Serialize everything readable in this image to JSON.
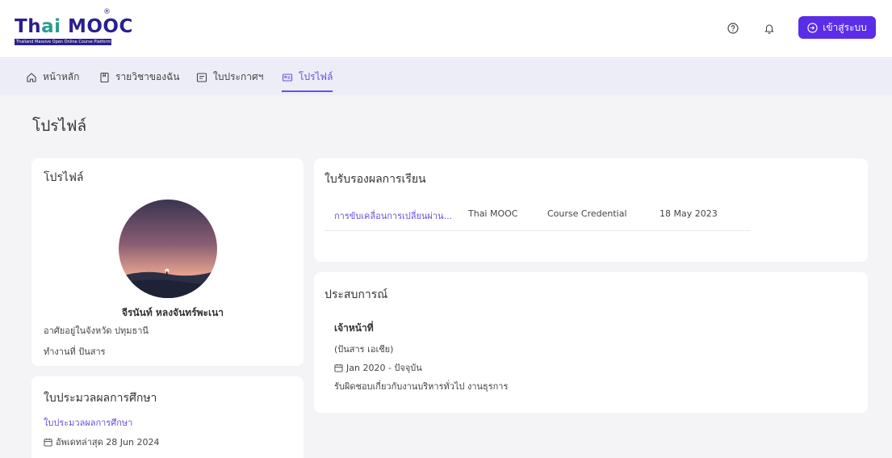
{
  "brand": {
    "logo_text_pre": "Th",
    "logo_text_ai": "ai",
    "logo_text_post": " MOOC",
    "logo_reg": "®",
    "logo_sub": "Thailand Massive Open Online Course Platform",
    "accent_color": "#5b2de8"
  },
  "header": {
    "help_icon": "help-icon",
    "bell_icon": "bell-icon",
    "login_label": "เข้าสู่ระบบ"
  },
  "nav": {
    "items": [
      {
        "label": "หน้าหลัก",
        "icon": "home-icon"
      },
      {
        "label": "รายวิชาของฉัน",
        "icon": "book-icon"
      },
      {
        "label": "ใบประกาศฯ",
        "icon": "certificate-icon"
      },
      {
        "label": "โปรไฟล์",
        "icon": "id-card-icon",
        "active": true
      }
    ]
  },
  "page_title": "โปรไฟล์",
  "profile": {
    "title": "โปรไฟล์",
    "name": "จีรนันท์ หลงจันทร์พะเนา",
    "location": "อาศัยอยู่ในจังหวัด ปทุมธานี",
    "work": "ทำงานที่ ปันสาร"
  },
  "transcript": {
    "title": "ใบประมวลผลการศึกษา",
    "link": "ใบประมวลผลการศึกษา",
    "updated": "อัพเดทล่าสุด 28 Jun 2024"
  },
  "certificates": {
    "title": "ใบรับรองผลการเรียน",
    "rows": [
      {
        "course": "การขับเคลื่อนการเปลี่ยนผ่าน...",
        "provider": "Thai MOOC",
        "type": "Course Credential",
        "date": "18 May 2023"
      }
    ]
  },
  "experience": {
    "title": "ประสบการณ์",
    "position": "เจ้าหน้าที่",
    "company": "(ปันสาร เอเชีย)",
    "period": "Jan 2020 - ปัจจุบัน",
    "description": "รับผิดชอบเกี่ยวกับงานบริหารทั่วไป งานธุรการ"
  }
}
